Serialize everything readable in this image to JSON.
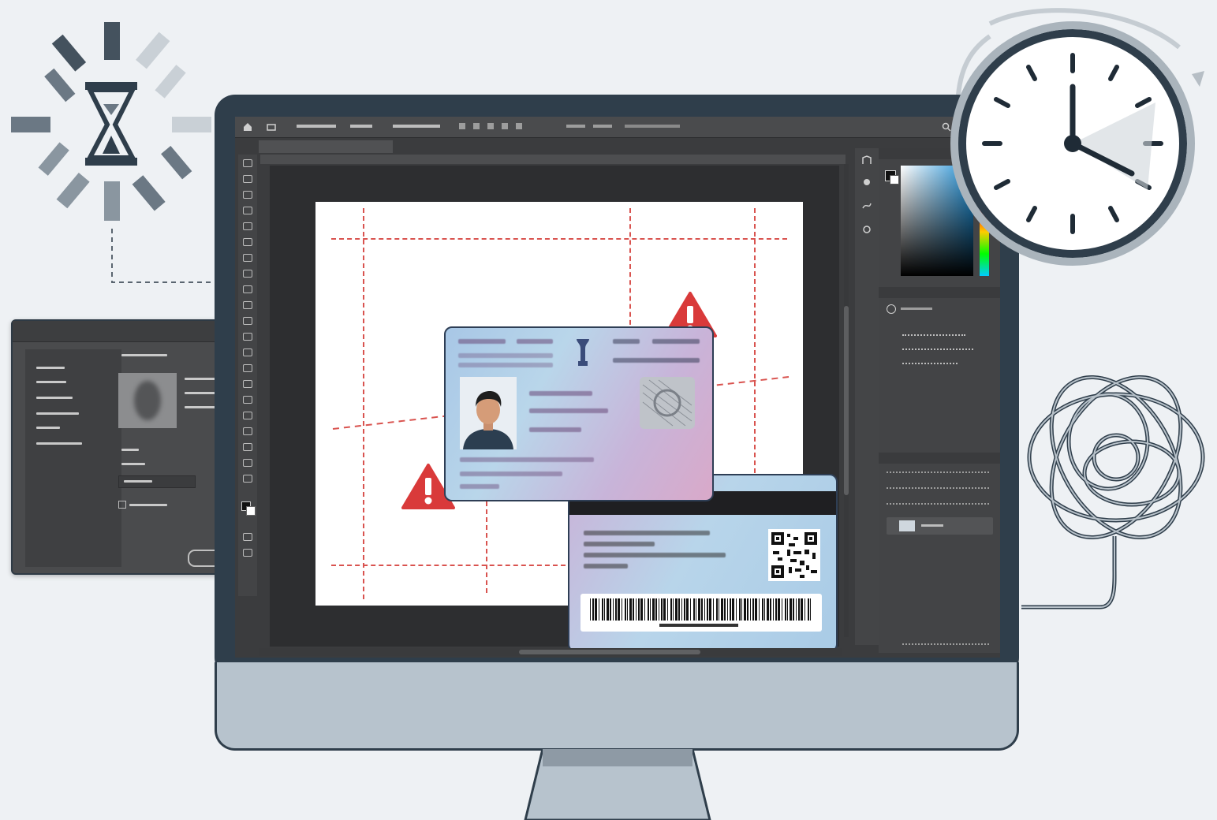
{
  "decor": {
    "hourglass_icon": "hourglass-icon",
    "spinner_icon": "loading-spinner-icon",
    "clock_icon": "clock-icon",
    "tangle_icon": "tangled-cable-icon"
  },
  "dialog": {
    "title": "",
    "menu_lines": 6
  },
  "photoshop": {
    "menu": [],
    "doc_tab": "",
    "tools_count": 26,
    "panels": {
      "color_tab": "",
      "properties_tab": "",
      "layers_tab": ""
    }
  },
  "card_front": {
    "title_left": "",
    "title_right": "",
    "photo_icon": "person-photo-icon",
    "emblem_icon": "national-emblem-icon",
    "hologram_icon": "hologram-icon"
  },
  "card_back": {
    "qr_icon": "qr-code-icon",
    "barcode_icon": "barcode-icon"
  },
  "warnings": [
    "warning-icon",
    "warning-icon"
  ],
  "colors": {
    "guide": "#d9534f",
    "warning": "#d93a3a",
    "bezel": "#2f3e4b",
    "app_bg": "#3b3c3e",
    "card_border": "#2e3e55"
  }
}
